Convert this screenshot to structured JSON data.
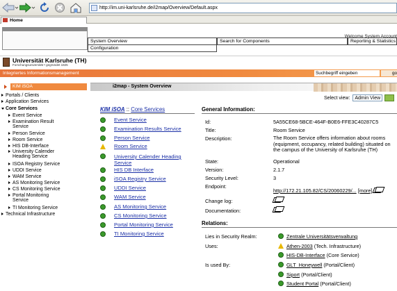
{
  "browser": {
    "url": "http://im.uni-karlsruhe.de/i2map/Overview/Default.aspx",
    "tab_label": "Home"
  },
  "header": {
    "nav": [
      "System Overview",
      "Search for Components",
      "Reporting & Statistics",
      "Configuration"
    ],
    "welcome": "Welcome System Account",
    "brand_name": "Universität Karlsruhe (TH)",
    "brand_sub": "Forschungsuniversität • gegründet 1825"
  },
  "orangebar": {
    "left_text": "Integriertes Informationsmanagement",
    "search_placeholder": "Suchbegriff eingeben",
    "go_label": "go"
  },
  "sidebar": {
    "selected": "KIM iSOA",
    "items": [
      {
        "label": "Portals / Clients",
        "level": 0,
        "expanded": false
      },
      {
        "label": "Application Services",
        "level": 0,
        "expanded": false
      },
      {
        "label": "Core Services",
        "level": 0,
        "expanded": true
      },
      {
        "label": "Event Service",
        "level": 1,
        "expanded": false
      },
      {
        "label": "Examination Result",
        "label2": "Service",
        "level": 1,
        "expanded": false
      },
      {
        "label": "Person Service",
        "level": 1,
        "expanded": false
      },
      {
        "label": "Room Service",
        "level": 1,
        "expanded": false
      },
      {
        "label": "HIS DB-Interface",
        "level": 1,
        "expanded": false
      },
      {
        "label": "University Calender",
        "label2": "Heading Service",
        "level": 1,
        "expanded": false
      },
      {
        "label": "ISOA Registry Service",
        "level": 1,
        "expanded": false
      },
      {
        "label": "UDDI Service",
        "level": 1,
        "expanded": false
      },
      {
        "label": "WAM Service",
        "level": 1,
        "expanded": false
      },
      {
        "label": "AS Monitoring Service",
        "level": 1,
        "expanded": false
      },
      {
        "label": "CS Monitoring Service",
        "level": 1,
        "expanded": false
      },
      {
        "label": "Portal Monitoring",
        "label2": "Service",
        "level": 1,
        "expanded": false
      },
      {
        "label": "TI Monitoring Service",
        "level": 1,
        "expanded": false
      },
      {
        "label": "Technical Infrastructure",
        "level": 0,
        "expanded": false
      }
    ]
  },
  "content": {
    "title": "i2map - System Overview",
    "select_view_label": "Select view:",
    "select_view_value": "Admin View",
    "breadcrumb_root": "KIM iSOA",
    "breadcrumb_sep": "::",
    "breadcrumb_leaf": "Core Services",
    "services": [
      {
        "name": "Event Service",
        "status": "ok"
      },
      {
        "name": "Examination Results Service",
        "status": "ok"
      },
      {
        "name": "Person Service",
        "status": "ok"
      },
      {
        "name": "Room Service",
        "status": "warn"
      },
      {
        "name": "University Calender Heading",
        "name2": "Service",
        "status": "ok"
      },
      {
        "name": "HIS DB Interface",
        "status": "ok"
      },
      {
        "name": "iSOA Registry Service",
        "status": "ok"
      },
      {
        "name": "UDDI Service",
        "status": "ok"
      },
      {
        "name": "WAM Service",
        "status": "ok"
      },
      {
        "name": "AS Monitoring Service",
        "status": "ok"
      },
      {
        "name": "CS Monitoring Service",
        "status": "ok"
      },
      {
        "name": "Portal Monitoring Service",
        "status": "ok"
      },
      {
        "name": "TI Monitoring Service",
        "status": "ok"
      }
    ],
    "general": {
      "heading": "General Information:",
      "id_label": "Id:",
      "id": "5A55CE68-5BCE-464F-B0E6-FFE3C40287C5",
      "title_label": "Title:",
      "title": "Room Service",
      "desc_label": "Description:",
      "description": "The Room Service offers information about rooms (equipment, occupancy, related building) situated on the campus of the University of Karlsruhe (TH)",
      "state_label": "State:",
      "state": "Operational",
      "version_label": "Version:",
      "version": "2.1.7",
      "security_label": "Security Level:",
      "security": "3",
      "endpoint_label": "Endpoint:",
      "endpoint": "http://172.21.105.82/CS/20060229/...",
      "endpoint_more": "[more]",
      "changelog_label": "Change log:",
      "docs_label": "Documentation:"
    },
    "relations": {
      "heading": "Relations:",
      "realm_label": "Lies in Security Realm:",
      "realm": {
        "name": "Zentrale Universitätsverwaltung",
        "suffix": "",
        "status": "ok"
      },
      "uses_label": "Uses:",
      "uses": [
        {
          "name": "Athen-2003",
          "suffix": "(Tech. Infrastructure)",
          "status": "warn"
        },
        {
          "name": "HIS-DB-Interface",
          "suffix": "(Core Service)",
          "status": "ok"
        }
      ],
      "usedby_label": "Is used By:",
      "usedby": [
        {
          "name": "GLT_Honeywell",
          "suffix": "(Portal/Client)",
          "status": "ok"
        },
        {
          "name": "Siport",
          "suffix": "(Portal/Client)",
          "status": "ok"
        },
        {
          "name": "Student Portal",
          "suffix": "(Portal/Client)",
          "status": "ok"
        }
      ]
    }
  }
}
